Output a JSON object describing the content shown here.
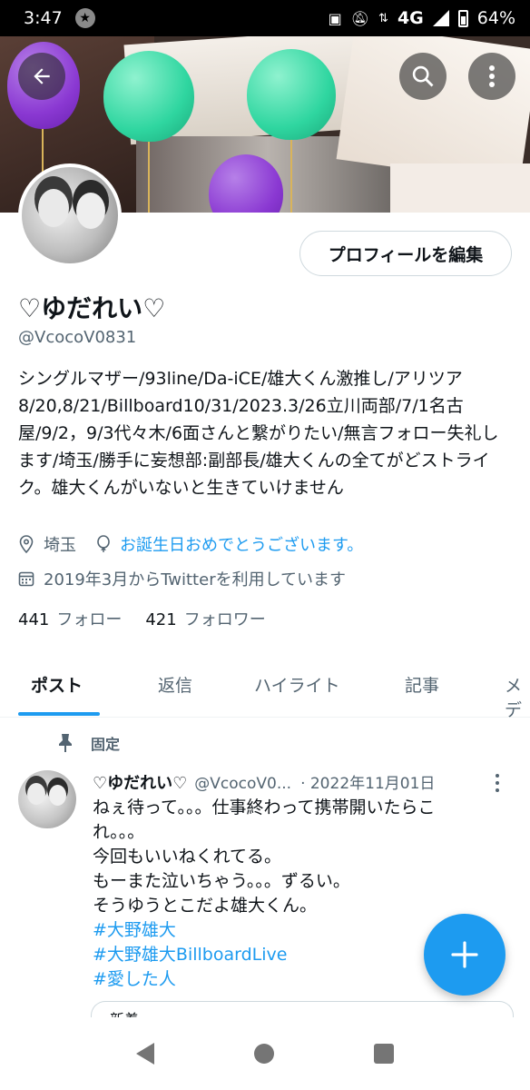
{
  "status_bar": {
    "time": "3:47",
    "network": "4G",
    "battery": "64%"
  },
  "profile": {
    "edit_button_label": "プロフィールを編集",
    "display_name": "♡ゆだれい♡",
    "handle": "@VcocoV0831",
    "bio": "シングルマザー/93line/Da-iCE/雄大くん激推し/アリツア8/20,8/21/Billboard10/31/2023.3/26立川両部/7/1名古屋/9/2，9/3代々木/6面さんと繋がりたい/無言フォロー失礼します/埼玉/勝手に妄想部:副部長/雄大くんの全てがどストライク。雄大くんがいないと生きていけません",
    "location": "埼玉",
    "birthday": "お誕生日おめでとうございます。",
    "joined": "2019年3月からTwitterを利用しています",
    "following_count": "441",
    "following_label": "フォロー",
    "followers_count": "421",
    "followers_label": "フォロワー"
  },
  "tabs": [
    {
      "label": "ポスト"
    },
    {
      "label": "返信"
    },
    {
      "label": "ハイライト"
    },
    {
      "label": "記事"
    },
    {
      "label": "メデ"
    }
  ],
  "pinned_post": {
    "pin_label": "固定",
    "author_name": "♡ゆだれい♡",
    "author_handle": "@VcocoV0...",
    "date": "· 2022年11月01日",
    "lines": [
      "ねぇ待って。。。仕事終わって携帯開いたらこ",
      "れ。。。",
      "今回もいいねくれてる。",
      "もーまた泣いちゃう。。。ずるい。",
      "そうゆうとこだよ雄大くん。"
    ],
    "hashtags": [
      "#大野雄大",
      "#大野雄大BillboardLive",
      "#愛した人"
    ],
    "quote_preview": "新着"
  },
  "colors": {
    "accent": "#1d9bf0",
    "text": "#0f1419",
    "muted": "#536471"
  },
  "icons": {
    "back": "arrow-left-icon",
    "search": "search-icon",
    "more": "more-vertical-icon",
    "location": "location-pin-icon",
    "birthday": "balloon-icon",
    "calendar": "calendar-icon",
    "pin": "pin-icon",
    "compose": "plus-icon"
  }
}
